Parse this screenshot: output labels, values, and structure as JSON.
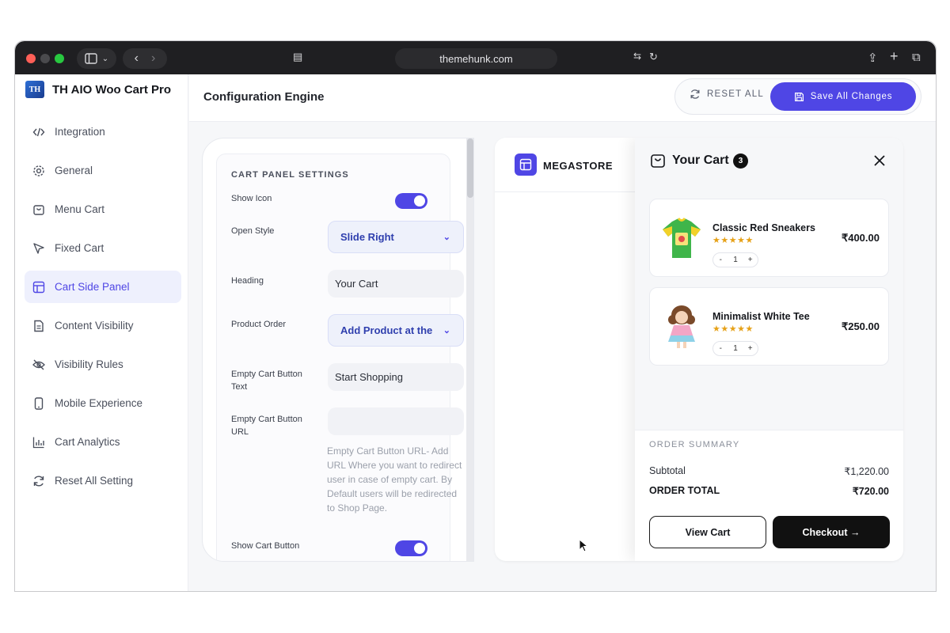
{
  "browser": {
    "url": "themehunk.com"
  },
  "sidebar": {
    "brand_logo_text": "TH",
    "brand_title": "TH AIO Woo Cart Pro",
    "items": [
      {
        "label": "Integration",
        "icon": "code-icon"
      },
      {
        "label": "General",
        "icon": "gear-icon"
      },
      {
        "label": "Menu Cart",
        "icon": "bag-icon"
      },
      {
        "label": "Fixed Cart",
        "icon": "pointer-icon"
      },
      {
        "label": "Cart Side Panel",
        "icon": "layout-icon",
        "active": true
      },
      {
        "label": "Content Visibility",
        "icon": "document-icon"
      },
      {
        "label": "Visibility Rules",
        "icon": "eye-off-icon"
      },
      {
        "label": "Mobile Experience",
        "icon": "phone-icon"
      },
      {
        "label": "Cart Analytics",
        "icon": "chart-icon"
      },
      {
        "label": "Reset All Setting",
        "icon": "refresh-icon"
      }
    ]
  },
  "header": {
    "title": "Configuration Engine",
    "reset_label": "RESET ALL",
    "save_label": "Save All Changes"
  },
  "settings": {
    "section_title": "CART PANEL SETTINGS",
    "show_icon_label": "Show Icon",
    "show_icon_on": true,
    "open_style_label": "Open Style",
    "open_style_value": "Slide Right",
    "heading_label": "Heading",
    "heading_value": "Your Cart",
    "product_order_label": "Product Order",
    "product_order_value": "Add Product at the",
    "empty_btn_text_label": "Empty Cart Button Text",
    "empty_btn_text_value": "Start Shopping",
    "empty_btn_url_label": "Empty Cart Button URL",
    "empty_btn_url_value": "",
    "empty_btn_url_help": "Empty Cart Button URL- Add URL Where you want to redirect user in case of empty cart. By Default users will be redirected to Shop Page.",
    "show_cart_button_label": "Show Cart Button",
    "show_cart_button_on": true
  },
  "preview": {
    "store_name": "MEGASTORE",
    "cart_title": "Your Cart",
    "cart_count": "3",
    "items": [
      {
        "name": "Classic Red Sneakers",
        "stars": "★★★★★",
        "price": "₹400.00",
        "qty": "1"
      },
      {
        "name": "Minimalist White Tee",
        "stars": "★★★★★",
        "price": "₹250.00",
        "qty": "1"
      }
    ],
    "summary_title": "ORDER SUMMARY",
    "subtotal_label": "Subtotal",
    "subtotal_value": "₹1,220.00",
    "total_label": "ORDER TOTAL",
    "total_value": "₹720.00",
    "view_cart_label": "View Cart",
    "checkout_label": "Checkout →"
  },
  "colors": {
    "accent": "#4f46e5",
    "dark": "#111111",
    "star": "#e6a118"
  }
}
